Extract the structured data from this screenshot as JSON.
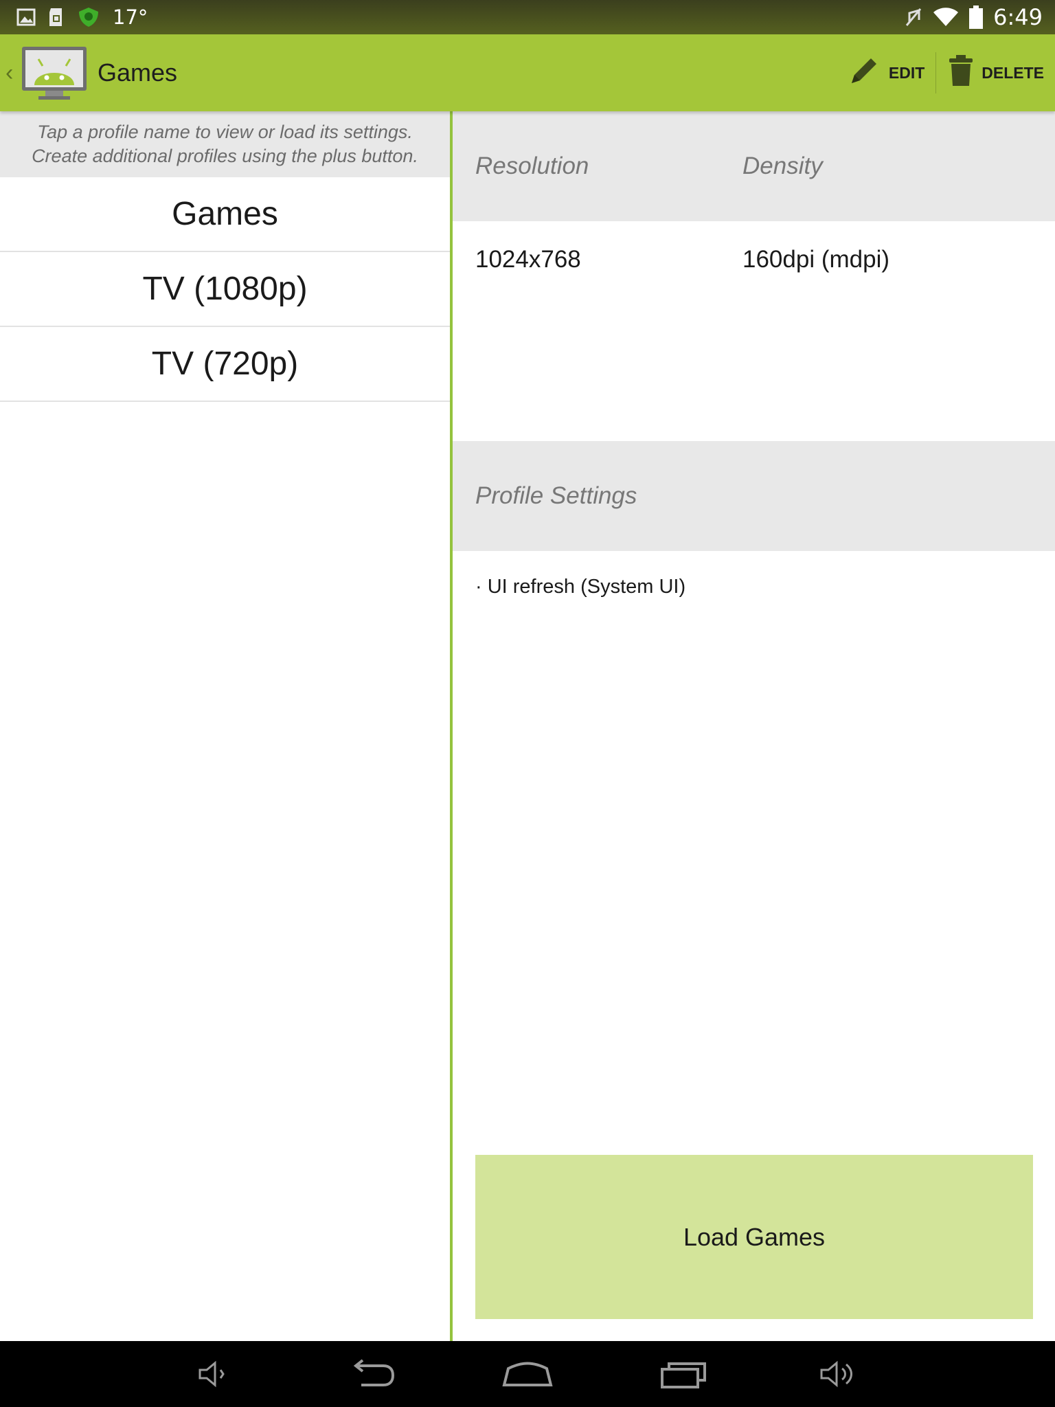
{
  "status_bar": {
    "temperature": "17°",
    "time": "6:49",
    "left_icons": [
      "image-icon",
      "sd-card-icon",
      "shield-icon"
    ],
    "right_icons": [
      "mute-icon",
      "wifi-icon",
      "battery-icon"
    ]
  },
  "action_bar": {
    "title": "Games",
    "edit_label": "EDIT",
    "delete_label": "DELETE",
    "accent_color": "#a4c639"
  },
  "left_pane": {
    "hint_line1": "Tap a profile name to view or load its settings.",
    "hint_line2": "Create additional profiles using the plus button.",
    "profiles": [
      {
        "label": "Games"
      },
      {
        "label": "TV (1080p)"
      },
      {
        "label": "TV (720p)"
      }
    ]
  },
  "details": {
    "resolution_header": "Resolution",
    "density_header": "Density",
    "resolution_value": "1024x768",
    "density_value": "160dpi (mdpi)",
    "profile_settings_header": "Profile Settings",
    "settings": [
      "· UI refresh (System UI)"
    ],
    "load_button_label": "Load Games"
  },
  "nav_bar": {
    "buttons": [
      "volume-down-icon",
      "back-icon",
      "home-icon",
      "recents-icon",
      "volume-up-icon"
    ]
  }
}
